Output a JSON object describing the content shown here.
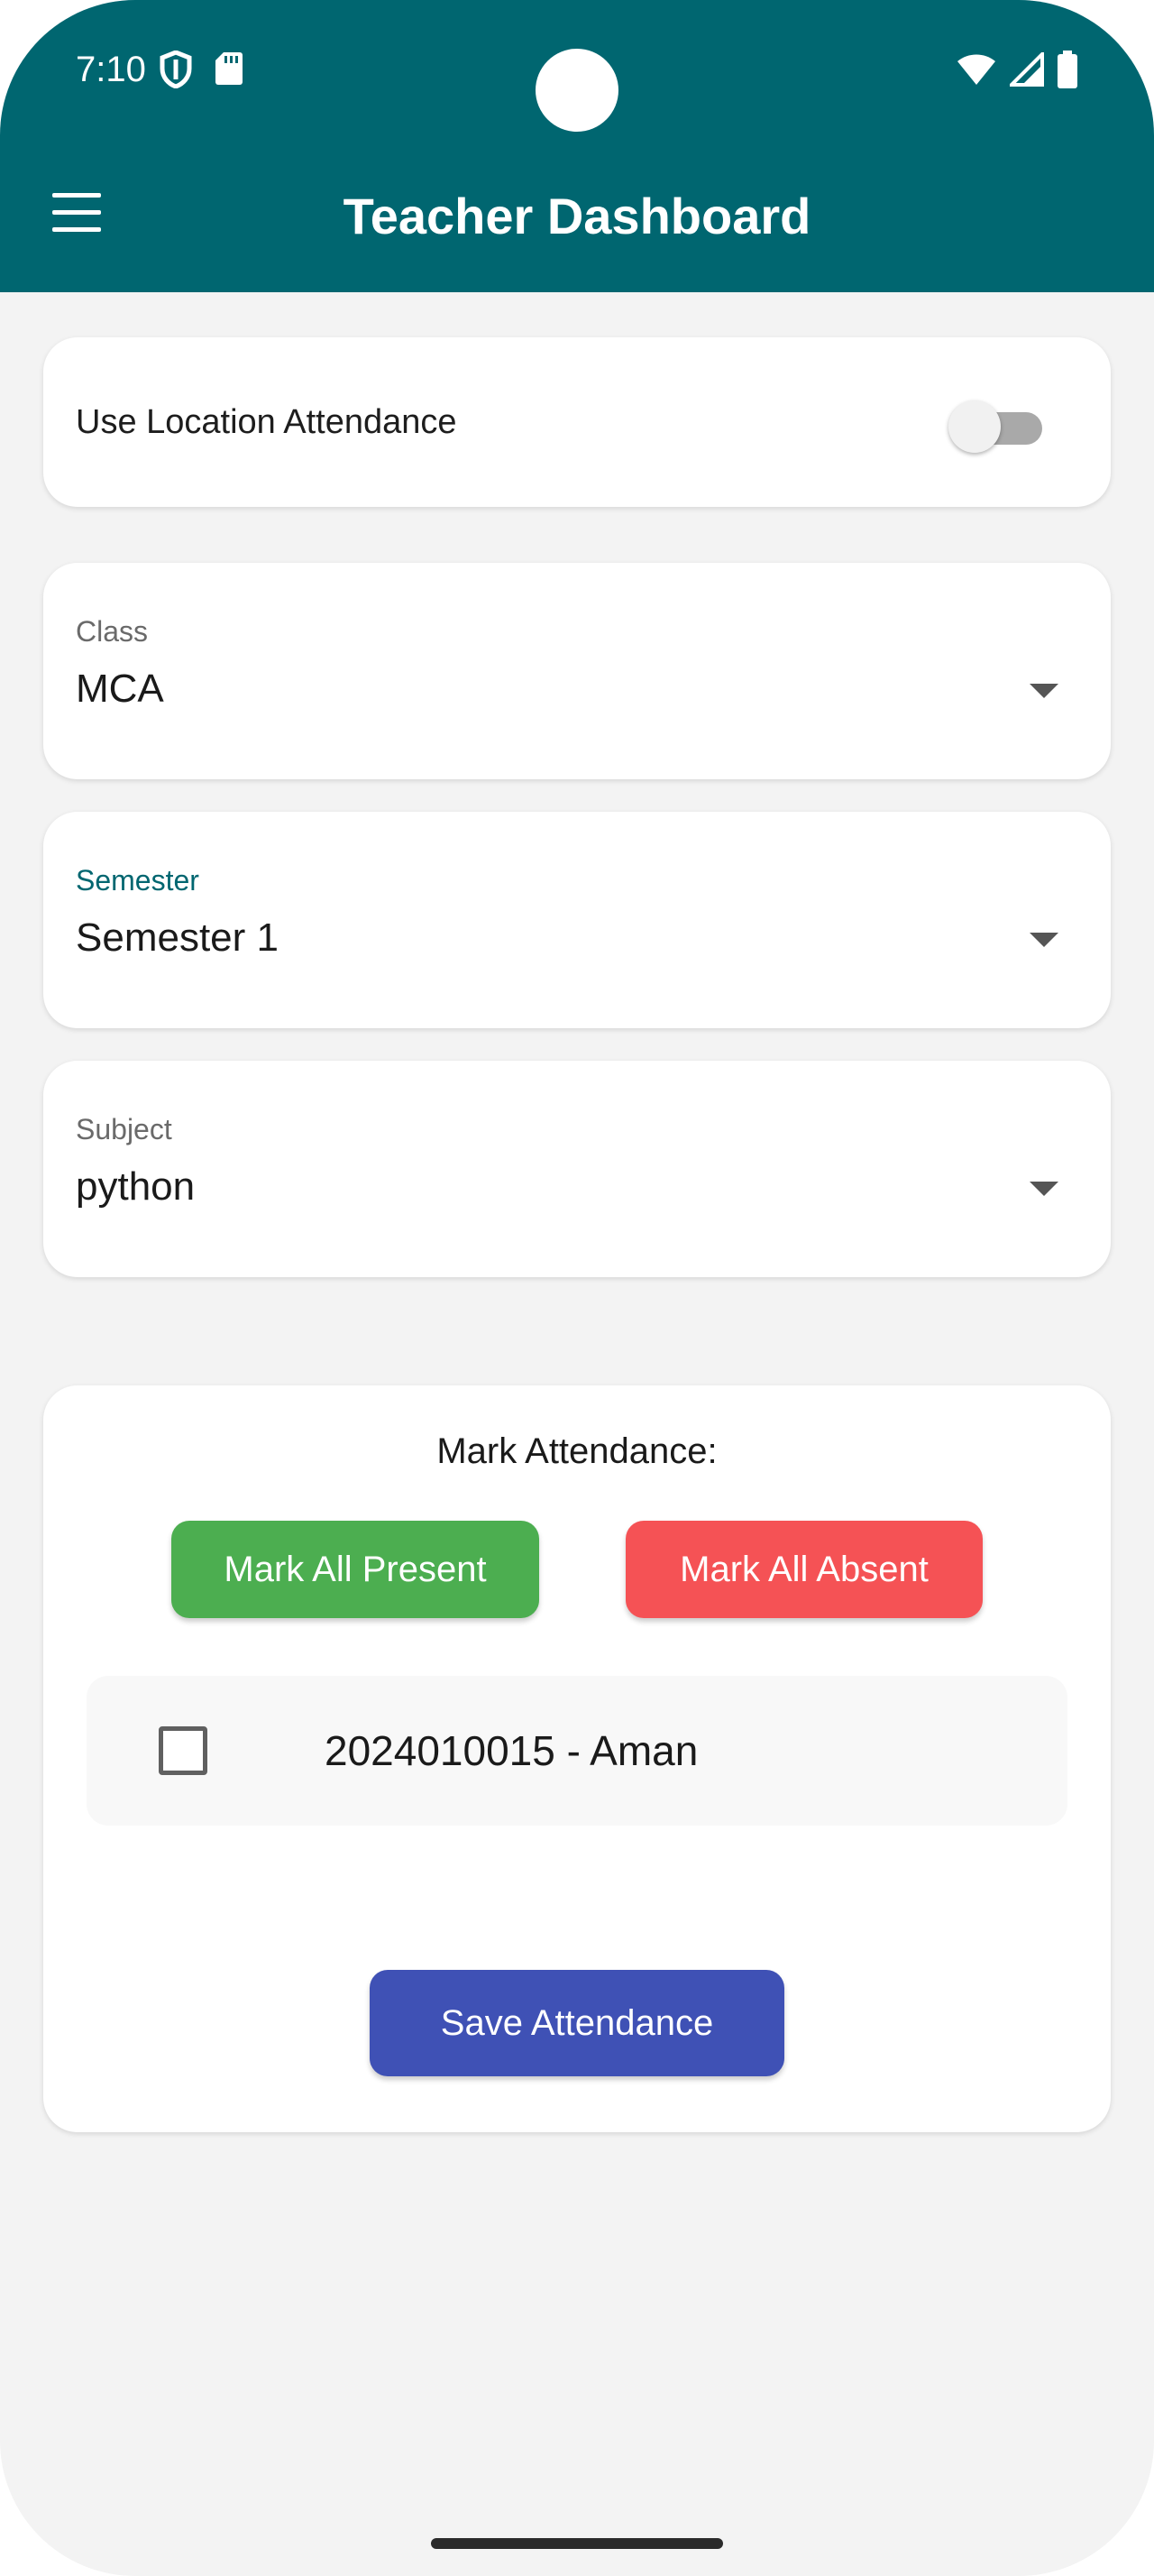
{
  "status_bar": {
    "time": "7:10",
    "left_icons": [
      "shield-icon",
      "sd-card-icon"
    ],
    "right_icons": [
      "wifi-icon",
      "signal-icon",
      "battery-icon"
    ]
  },
  "app_bar": {
    "menu_icon": "hamburger-menu-icon",
    "title": "Teacher Dashboard",
    "color": "#006670"
  },
  "location_toggle": {
    "label": "Use Location Attendance",
    "enabled": false
  },
  "filters": {
    "class": {
      "label": "Class",
      "value": "MCA"
    },
    "semester": {
      "label": "Semester",
      "value": "Semester 1"
    },
    "subject": {
      "label": "Subject",
      "value": "python"
    }
  },
  "attendance": {
    "title": "Mark Attendance:",
    "mark_all_present_label": "Mark All Present",
    "mark_all_absent_label": "Mark All Absent",
    "students": [
      {
        "label": "2024010015 - Aman",
        "checked": false
      }
    ],
    "save_label": "Save Attendance"
  },
  "colors": {
    "present": "#4cae50",
    "absent": "#f55255",
    "save": "#3f51b5",
    "accent": "#006670"
  }
}
